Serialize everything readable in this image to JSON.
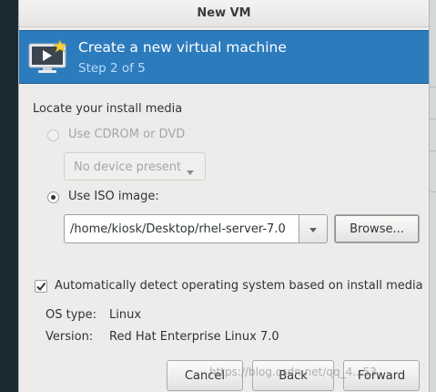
{
  "window": {
    "title": "New VM"
  },
  "banner": {
    "title": "Create a new virtual machine",
    "step": "Step 2 of 5"
  },
  "media": {
    "heading": "Locate your install media",
    "cdrom_label": "Use CDROM or DVD",
    "cdrom_selected": false,
    "cdrom_enabled": false,
    "device_combo_value": "No device present",
    "iso_label": "Use ISO image:",
    "iso_selected": true,
    "iso_path": "/home/kiosk/Desktop/rhel-server-7.0",
    "browse_label": "Browse..."
  },
  "autodetect": {
    "label": "Automatically detect operating system based on install media",
    "checked": true,
    "os_type_label": "OS type:",
    "os_type_value": "Linux",
    "version_label": "Version:",
    "version_value": "Red Hat Enterprise Linux 7.0"
  },
  "buttons": {
    "cancel": "Cancel",
    "back": "Back",
    "forward": "Forward"
  },
  "watermark": "https://blog.csdn.net/qq_4...53",
  "colors": {
    "banner": "#2c7bbd",
    "banner_step": "#b8dcf6"
  }
}
